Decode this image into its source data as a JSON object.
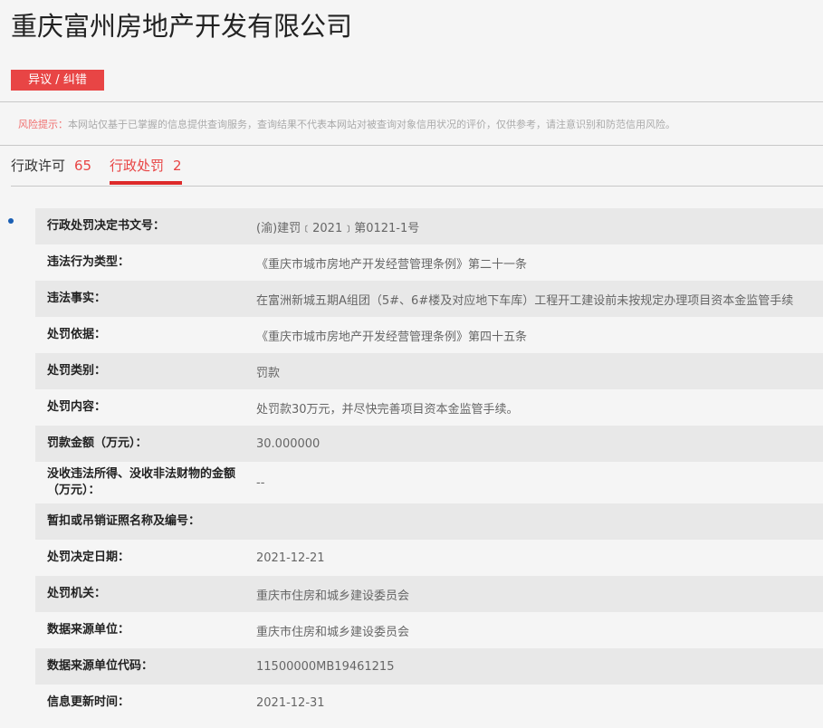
{
  "company_name": "重庆富州房地产开发有限公司",
  "dispute_button": "异议 / 纠错",
  "risk": {
    "label": "风险提示：",
    "text": "本网站仅基于已掌握的信息提供查询服务，查询结果不代表本网站对被查询对象信用状况的评价，仅供参考，请注意识别和防范信用风险。"
  },
  "tabs": [
    {
      "label": "行政许可",
      "count": "65",
      "active": false
    },
    {
      "label": "行政处罚",
      "count": "2",
      "active": true
    }
  ],
  "records": [
    {
      "key": "行政处罚决定书文号：",
      "value": "(渝)建罚﹝2021﹞第0121-1号"
    },
    {
      "key": "违法行为类型：",
      "value": "《重庆市城市房地产开发经营管理条例》第二十一条"
    },
    {
      "key": "违法事实：",
      "value": "在富洲新城五期A组团（5#、6#楼及对应地下车库）工程开工建设前未按规定办理项目资本金监管手续"
    },
    {
      "key": "处罚依据：",
      "value": "《重庆市城市房地产开发经营管理条例》第四十五条"
    },
    {
      "key": "处罚类别：",
      "value": "罚款"
    },
    {
      "key": "处罚内容：",
      "value": "处罚款30万元，并尽快完善项目资本金监管手续。"
    },
    {
      "key": "罚款金额（万元）：",
      "value": "30.000000"
    },
    {
      "key": "没收违法所得、没收非法财物的金额（万元）：",
      "value": "--"
    },
    {
      "key": "暂扣或吊销证照名称及编号：",
      "value": ""
    },
    {
      "key": "处罚决定日期：",
      "value": "2021-12-21"
    },
    {
      "key": "处罚机关：",
      "value": "重庆市住房和城乡建设委员会"
    },
    {
      "key": "数据来源单位：",
      "value": "重庆市住房和城乡建设委员会"
    },
    {
      "key": "数据来源单位代码：",
      "value": "11500000MB19461215"
    },
    {
      "key": "信息更新时间：",
      "value": "2021-12-31"
    }
  ]
}
